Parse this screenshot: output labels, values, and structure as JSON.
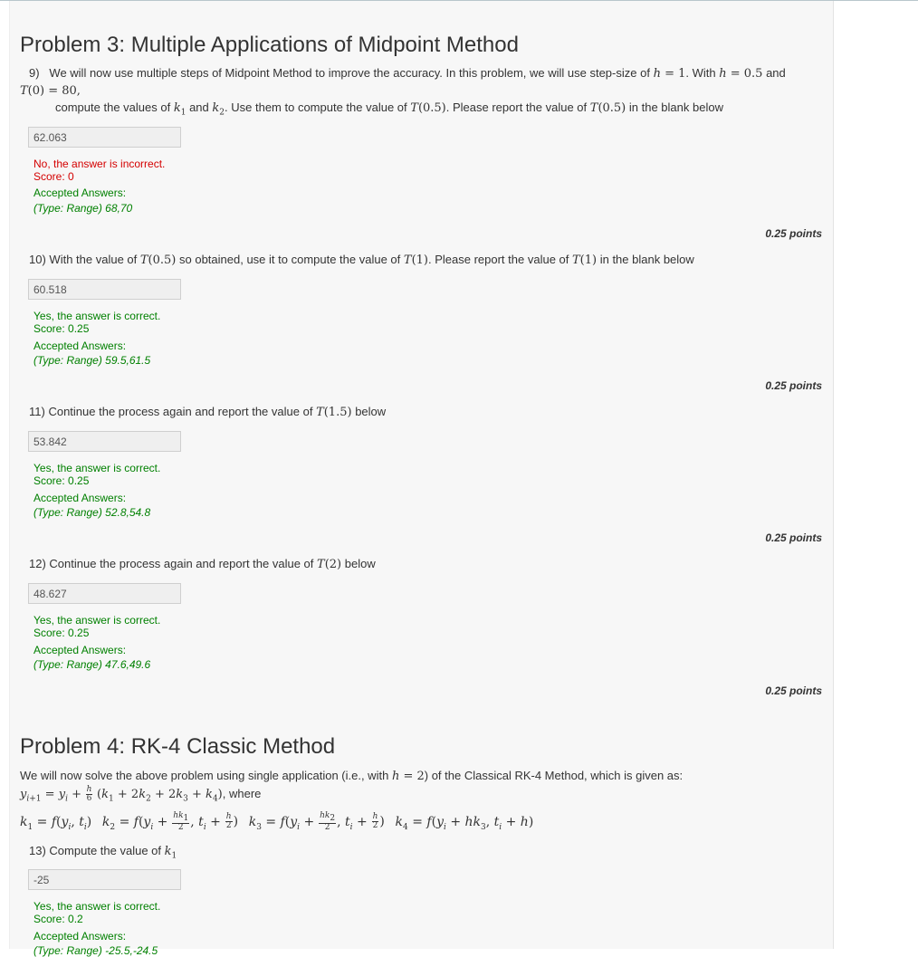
{
  "problem3": {
    "title": "Problem 3: Multiple Applications of Midpoint Method",
    "questions": [
      {
        "number": "9)",
        "text_a": "We will now use multiple steps of Midpoint Method to improve the accuracy. In this problem, we will use step-size of",
        "text_b": ". With",
        "text_c": "and",
        "text_d": "compute the values of",
        "text_e": "and",
        "text_f": ". Use them to compute the value of",
        "text_g": ". Please report the value of",
        "text_h": "in the blank below",
        "answer": "62.063",
        "feedback_status": "No, the answer is incorrect.",
        "score": "Score: 0",
        "accepted_label": "Accepted Answers:",
        "accepted": "(Type: Range) 68,70",
        "points": "0.25 points"
      },
      {
        "number": "10)",
        "text_a": "With the value of",
        "text_b": "so obtained, use it to compute the value of",
        "text_c": ". Please report the value of",
        "text_d": "in the blank below",
        "answer": "60.518",
        "feedback_status": "Yes, the answer is correct.",
        "score": "Score: 0.25",
        "accepted_label": "Accepted Answers:",
        "accepted": "(Type: Range) 59.5,61.5",
        "points": "0.25 points"
      },
      {
        "number": "11)",
        "text_a": "Continue the process again and report the value of",
        "text_b": "below",
        "answer": "53.842",
        "feedback_status": "Yes, the answer is correct.",
        "score": "Score: 0.25",
        "accepted_label": "Accepted Answers:",
        "accepted": "(Type: Range) 52.8,54.8",
        "points": "0.25 points"
      },
      {
        "number": "12)",
        "text_a": "Continue the process again and report the value of",
        "text_b": "below",
        "answer": "48.627",
        "feedback_status": "Yes, the answer is correct.",
        "score": "Score: 0.25",
        "accepted_label": "Accepted Answers:",
        "accepted": "(Type: Range) 47.6,49.6",
        "points": "0.25 points"
      }
    ]
  },
  "problem4": {
    "title": "Problem 4: RK-4 Classic Method",
    "intro_a": "We will now solve the above problem using single application (i.e., with",
    "intro_b": ") of the Classical RK-4 Method, which is given as:",
    "where": ", where",
    "question13": {
      "number": "13)",
      "text": "Compute the value of",
      "answer": "-25",
      "feedback_status": "Yes, the answer is correct.",
      "score": "Score: 0.2",
      "accepted_label": "Accepted Answers:",
      "accepted": "(Type: Range) -25.5,-24.5"
    }
  }
}
